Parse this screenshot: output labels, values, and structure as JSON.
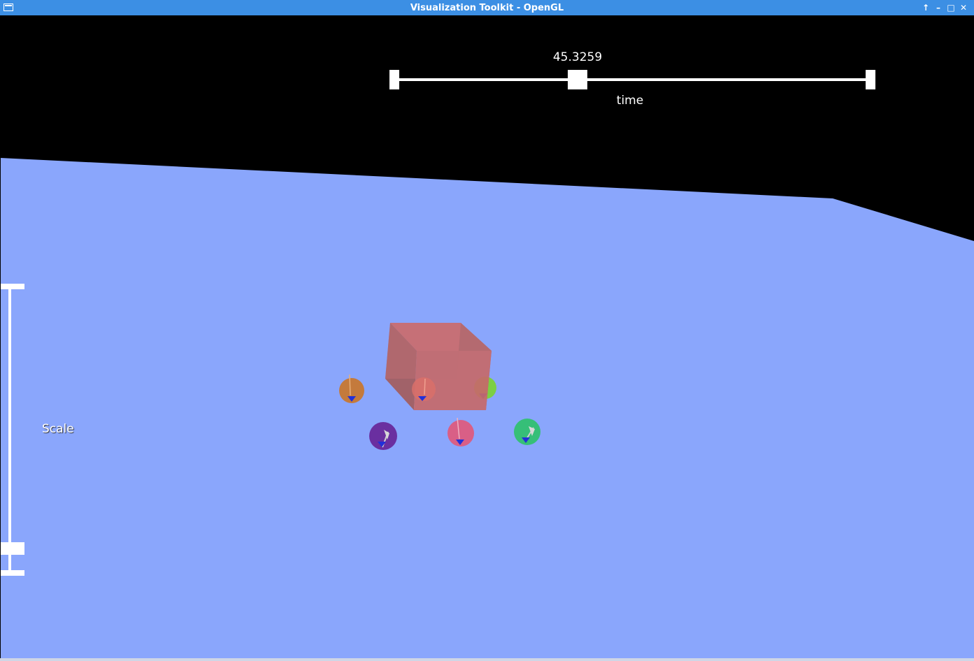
{
  "window": {
    "title": "Visualization Toolkit - OpenGL",
    "buttons": [
      "maximize-up",
      "minimize",
      "maximize",
      "close"
    ]
  },
  "colors": {
    "titlebar": "#3c8fe4",
    "background": "#000000",
    "ground": "#8aa6fc",
    "widget": "#ffffff",
    "box": "#d46e6e"
  },
  "time_slider": {
    "value": "45.3259",
    "label": "time",
    "fraction": 0.385
  },
  "scale_slider": {
    "label": "Scale",
    "fraction": 0.93
  },
  "scene": {
    "objects": [
      {
        "name": "box",
        "color": "#d46e6e"
      },
      {
        "name": "ball-orange",
        "color": "#c47a3c"
      },
      {
        "name": "ball-red",
        "color": "#d9706a"
      },
      {
        "name": "ball-green-light",
        "color": "#7ccf44"
      },
      {
        "name": "ball-purple",
        "color": "#6a2fa0"
      },
      {
        "name": "ball-pink",
        "color": "#d95f86"
      },
      {
        "name": "ball-green",
        "color": "#36bf78"
      }
    ]
  }
}
